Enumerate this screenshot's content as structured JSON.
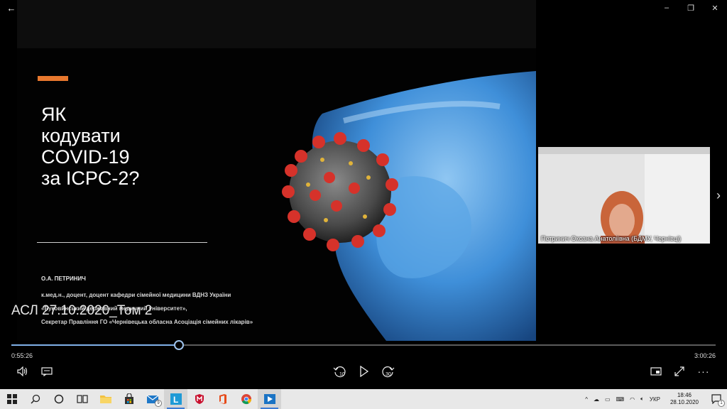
{
  "window": {
    "back_icon": "arrow-left-icon",
    "controls": [
      "minimize-icon",
      "restore-icon",
      "close-icon"
    ],
    "min_glyph": "–",
    "restore_glyph": "❐",
    "close_glyph": "✕",
    "back_glyph": "←"
  },
  "slide": {
    "accent_color": "#e8782e",
    "title_lines": [
      "ЯК",
      "кодувати",
      "COVID-19",
      "за ICPC-2?"
    ],
    "author": "О.А. ПЕТРИНИЧ",
    "bio_lines": [
      "к.мед.н., доцент, доцент кафедри сімейної медицини ВДНЗ України",
      "«Буковинський державний медичний університет»,",
      "Секретар Правління ГО «Чернівецька обласна Асоціація сімейних лікарів»"
    ]
  },
  "video": {
    "title": "АСЛ 27.10.2020_Том 2",
    "current_time": "0:55:26",
    "total_time": "3:00:26",
    "progress_fraction": 0.238
  },
  "participant": {
    "name": "Петринич Оксана Анатоліївна (БДМУ, Чернівці)"
  },
  "controls": {
    "skip_back_label": "10",
    "skip_forward_label": "30"
  },
  "taskbar": {
    "apps": [
      {
        "name": "start-button",
        "icon": "windows-icon"
      },
      {
        "name": "search-button",
        "icon": "search-icon"
      },
      {
        "name": "cortana-button",
        "icon": "circle-icon"
      },
      {
        "name": "task-view-button",
        "icon": "task-view-icon"
      },
      {
        "name": "explorer-app",
        "icon": "folder-icon"
      },
      {
        "name": "store-app",
        "icon": "store-icon"
      },
      {
        "name": "mail-app",
        "icon": "mail-icon",
        "badge": "9"
      },
      {
        "name": "l-app",
        "icon": "l-app-icon",
        "active": true
      },
      {
        "name": "mcafee-app",
        "icon": "shield-icon"
      },
      {
        "name": "office-app",
        "icon": "office-icon"
      },
      {
        "name": "chrome-app",
        "icon": "chrome-icon"
      },
      {
        "name": "movies-app",
        "icon": "film-icon",
        "active": true
      }
    ],
    "language": "УКР",
    "time": "18:46",
    "date": "28.10.2020",
    "notification_count": "1"
  }
}
